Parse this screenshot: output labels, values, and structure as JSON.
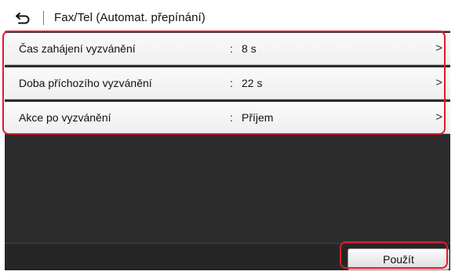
{
  "header": {
    "back_icon": "back-arrow-icon",
    "title": "Fax/Tel (Automat. přepínání)"
  },
  "settings": [
    {
      "label": "Čas zahájení vyzvánění",
      "value": "8 s"
    },
    {
      "label": "Doba příchozího vyzvánění",
      "value": "22 s"
    },
    {
      "label": "Akce po vyzvánění",
      "value": "Příjem"
    }
  ],
  "separator": ":",
  "chevron": ">",
  "footer": {
    "apply_label": "Použít"
  },
  "colors": {
    "highlight": "#e0192b",
    "screen_bg": "#2c2c2c"
  }
}
